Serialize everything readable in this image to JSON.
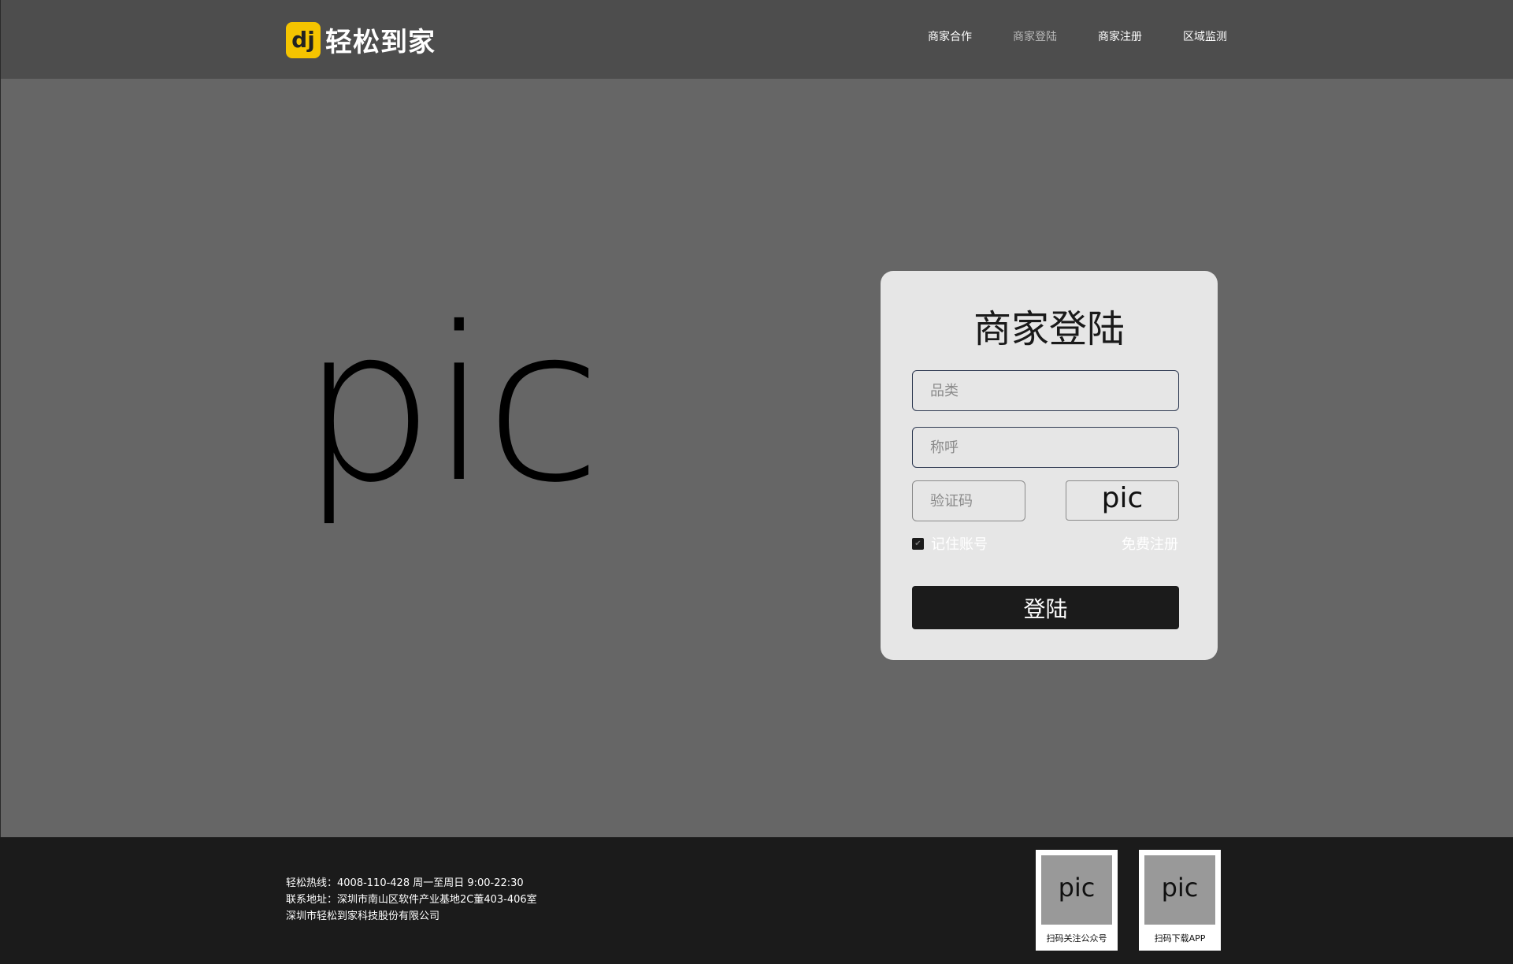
{
  "header": {
    "logo_glyph": "dj",
    "logo_text": "轻松到家",
    "nav": [
      "商家合作",
      "商家登陆",
      "商家注册",
      "区域监测"
    ],
    "active_nav": "商家登陆"
  },
  "hero": {
    "pic_label": "pic"
  },
  "login": {
    "title": "商家登陆",
    "category_placeholder": "品类",
    "name_placeholder": "称呼",
    "code_placeholder": "验证码",
    "captcha_label": "pic",
    "remember_label": "记住账号",
    "remember_checked": true,
    "register_link": "免费注册",
    "submit_label": "登陆"
  },
  "footer": {
    "hotline": "轻松热线：4008-110-428  周一至周日 9:00-22:30",
    "address": "联系地址：深圳市南山区软件产业基地2C董403-406室",
    "company": "深圳市轻松到家科技股份有限公司",
    "qr_codes": [
      {
        "pic_label": "pic",
        "caption": "扫码关注公众号"
      },
      {
        "pic_label": "pic",
        "caption": "扫码下载APP"
      }
    ]
  },
  "colors": {
    "header_bg": "#4d4d4d",
    "main_bg": "#666666",
    "footer_bg": "#1b1b1b",
    "card_bg": "#e6e6e6",
    "logo_accent": "#f5c400",
    "nav_active": "#b8b8b8"
  }
}
